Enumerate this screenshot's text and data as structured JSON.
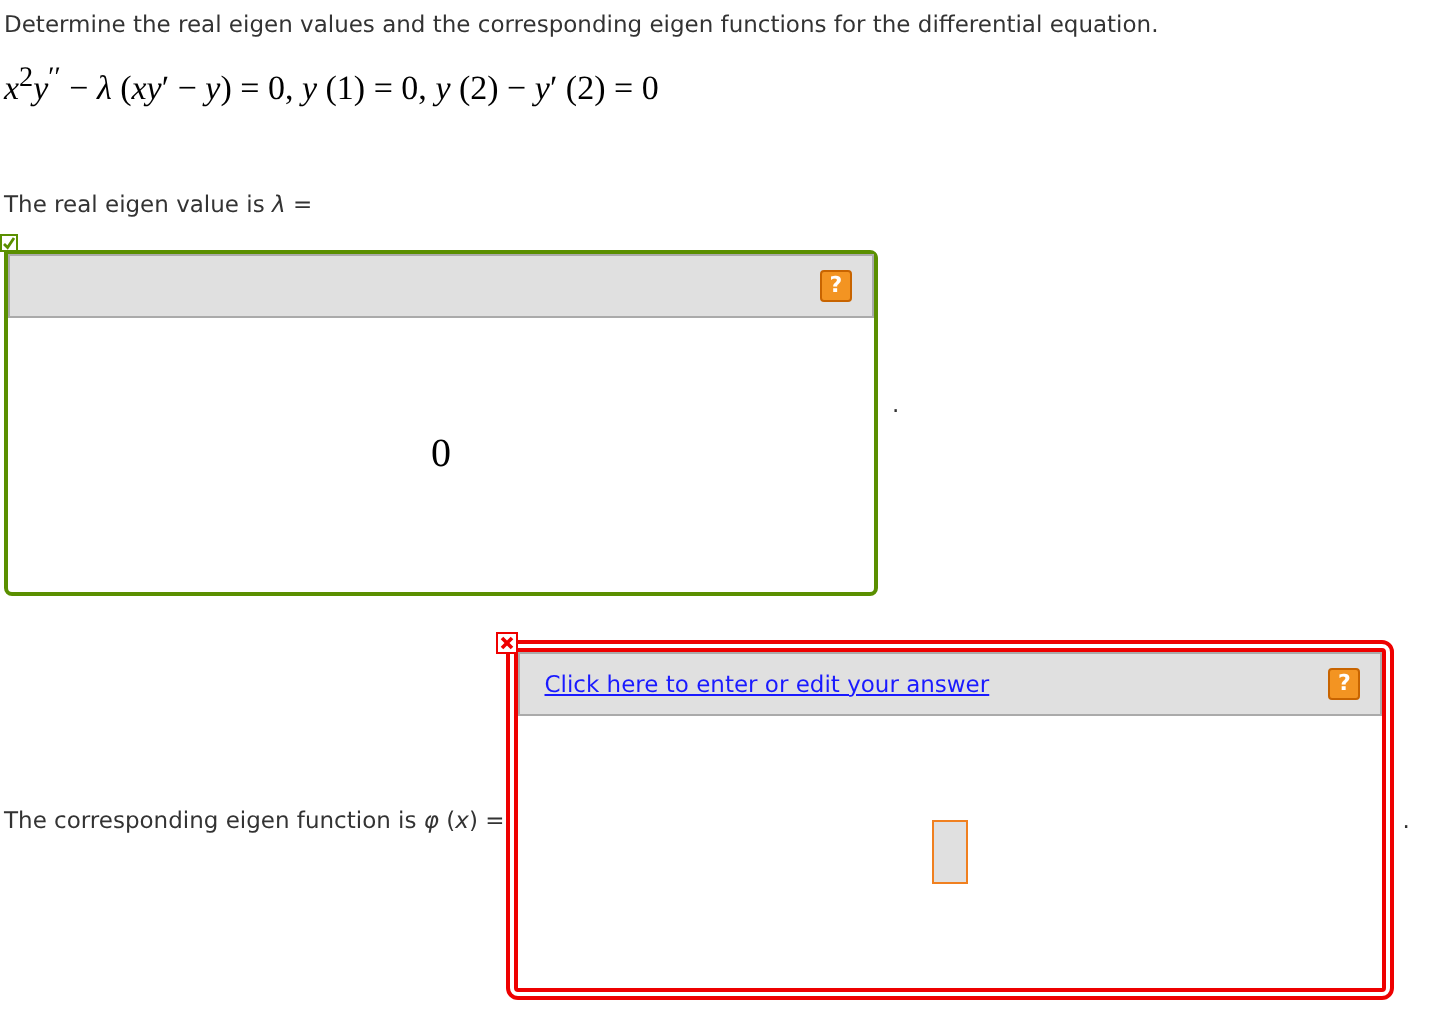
{
  "instruction": "Determine the real eigen values and the corresponding eigen functions for the differential equation.",
  "equation": "*x*$^{2}$*y*$^{′′}$ − *λ* (*xy*′ − *y*) = 0,  *y* (1) = 0,  *y* (2) − *y*′ (2) = 0",
  "answers": [
    {
      "prompt": "The real eigen value is *λ* =",
      "correct": true,
      "value": "0",
      "help": "?",
      "after": "."
    },
    {
      "prompt": "The corresponding eigen function is *φ* (*x*) =",
      "correct": false,
      "link": "Click here to enter or edit your answer",
      "help": "?",
      "after": "."
    }
  ]
}
